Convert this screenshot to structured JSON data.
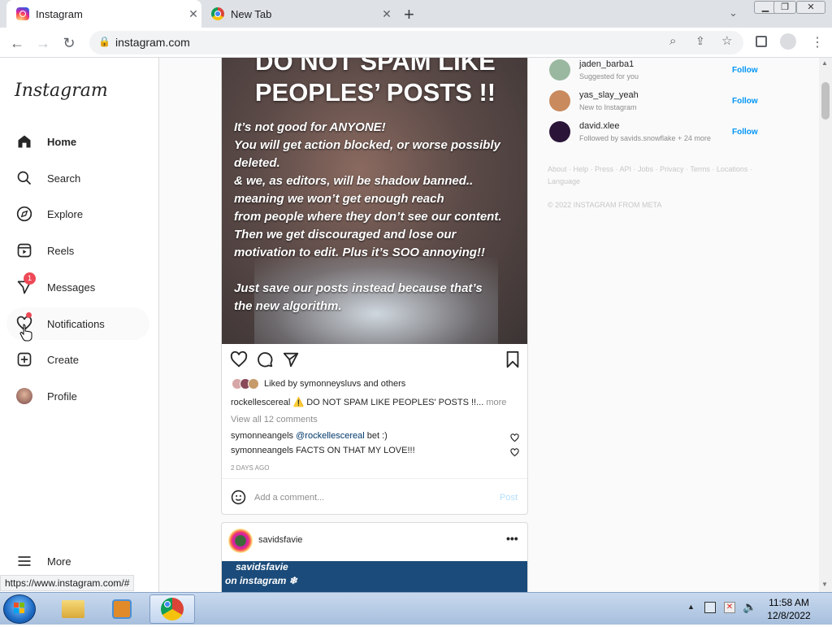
{
  "browser": {
    "tabs": [
      {
        "title": "Instagram",
        "active": true
      },
      {
        "title": "New Tab",
        "active": false
      }
    ],
    "new_tab_label": "+",
    "url": "instagram.com",
    "status_url": "https://www.instagram.com/#"
  },
  "sidebar": {
    "logo": "Instagram",
    "items": [
      {
        "label": "Home",
        "icon": "home-icon"
      },
      {
        "label": "Search",
        "icon": "search-icon"
      },
      {
        "label": "Explore",
        "icon": "compass-icon"
      },
      {
        "label": "Reels",
        "icon": "reels-icon"
      },
      {
        "label": "Messages",
        "icon": "messages-icon",
        "badge": "1"
      },
      {
        "label": "Notifications",
        "icon": "heart-icon"
      },
      {
        "label": "Create",
        "icon": "plus-square-icon"
      },
      {
        "label": "Profile",
        "icon": "avatar"
      }
    ],
    "more_label": "More"
  },
  "post": {
    "headline_1": "DO NOT SPAM LIKE",
    "headline_2": "PEOPLES’ POSTS !!",
    "body": "It’s not good for ANYONE!\nYou will get action blocked, or worse possibly deleted.\n& we, as editors, will be shadow banned..\nmeaning we won’t get enough reach\nfrom people where they don’t see our content.\nThen we get discouraged and lose our\nmotivation to edit. Plus it’s SOO annoying!!\n\nJust save our posts instead because that’s\nthe new algorithm.",
    "liked_by_prefix": "Liked by",
    "liked_by_user": "symonneysluvs",
    "liked_by_suffix": "and others",
    "caption_user": "rockellescereal",
    "caption_text": "⚠️ DO NOT SPAM LIKE PEOPLES' POSTS !!...",
    "caption_more": "more",
    "view_comments": "View all 12 comments",
    "comments": [
      {
        "user": "symonneangels",
        "mention": "@rockellescereal",
        "text": "bet :)"
      },
      {
        "user": "symonneangels",
        "mention": "",
        "text": "FACTS ON THAT MY LOVE!!!"
      }
    ],
    "timestamp": "2 DAYS AGO",
    "comment_placeholder": "Add a comment...",
    "post_button": "Post"
  },
  "post2": {
    "user": "savidsfavie",
    "image_text_1": "savidsfavie",
    "image_text_2": "on instagram ❄"
  },
  "suggestions": [
    {
      "name": "jaden_barba1",
      "sub": "Suggested for you",
      "follow": "Follow",
      "color": "#9ab8a0"
    },
    {
      "name": "yas_slay_yeah",
      "sub": "New to Instagram",
      "follow": "Follow",
      "color": "#c98a5e"
    },
    {
      "name": "david.xlee",
      "sub": "Followed by savids.snowflake + 24 more",
      "follow": "Follow",
      "color": "#2a1538"
    }
  ],
  "footer": {
    "links": "About · Help · Press · API · Jobs · Privacy · Terms · Locations ·",
    "links2": "Language",
    "copyright": "© 2022 INSTAGRAM FROM META"
  },
  "taskbar": {
    "time": "11:58 AM",
    "date": "12/8/2022"
  },
  "colors": {
    "accent": "#0095f6",
    "badge": "#ed4956"
  }
}
